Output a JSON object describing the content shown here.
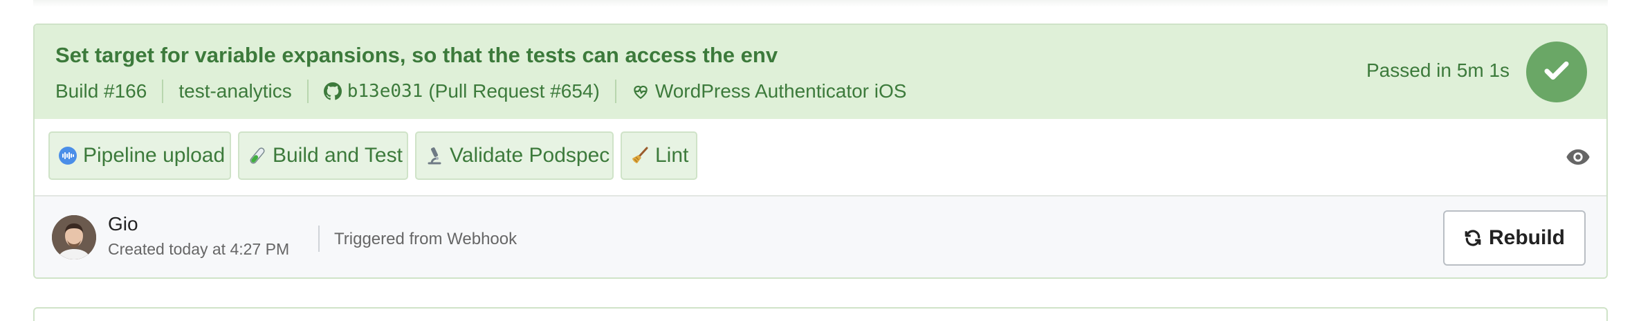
{
  "build": {
    "title": "Set target for variable expansions, so that the tests can access the env",
    "number": "Build #166",
    "branch": "test-analytics",
    "commit": "b13e031",
    "pull_request": "(Pull Request #654)",
    "pipeline": "WordPress Authenticator iOS",
    "status_text": "Passed in 5m 1s",
    "status_icon": "check-icon"
  },
  "steps": [
    {
      "label": "Pipeline upload",
      "icon": "pipeline-icon"
    },
    {
      "label": "Build and Test",
      "icon": "test-tube-icon"
    },
    {
      "label": "Validate Podspec",
      "icon": "microscope-icon"
    },
    {
      "label": "Lint",
      "icon": "broom-icon"
    }
  ],
  "footer": {
    "user_name": "Gio",
    "created": "Created today at 4:27 PM",
    "trigger": "Triggered from Webhook",
    "rebuild_label": "Rebuild"
  },
  "colors": {
    "success_bg": "#dff0d8",
    "success_text": "#3c7a3b",
    "success_badge": "#6aa766"
  }
}
